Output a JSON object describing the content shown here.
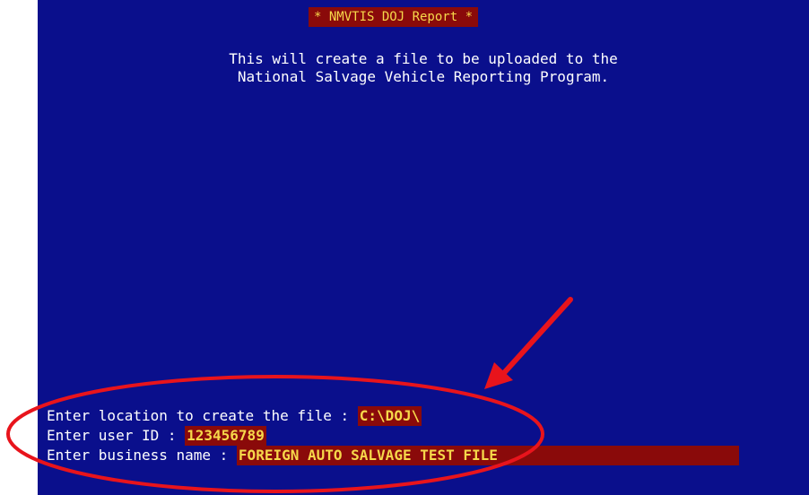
{
  "window": {
    "title": "* NMVTIS DOJ Report *"
  },
  "intro": {
    "line1": "This will create a file to be uploaded to the",
    "line2": "National Salvage Vehicle Reporting Program."
  },
  "form": {
    "location_label": "Enter location to create the file : ",
    "location_value": "C:\\DOJ\\",
    "user_id_label": "Enter user ID : ",
    "user_id_value": "123456789",
    "business_label": "Enter business name : ",
    "business_value": "FOREIGN AUTO SALVAGE TEST FILE"
  },
  "colors": {
    "screen_bg": "#0a0f8c",
    "field_bg": "#8a0a0a",
    "field_text": "#f6d84a",
    "annotation": "#e8141c"
  }
}
